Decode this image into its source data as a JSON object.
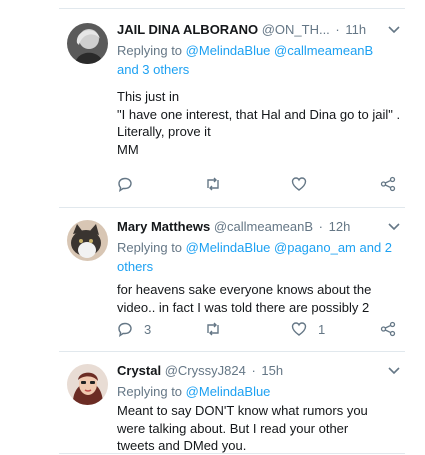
{
  "tweets": [
    {
      "name": "JAIL DINA ALBORANO",
      "handle": "@ON_TH...",
      "sep": "·",
      "time": "11h",
      "reply_prefix": "Replying to",
      "reply_to": "@MelindaBlue @callmeameanB",
      "reply_to_2": "and 3 others",
      "body": "This just in\n\"I have one interest, that Hal and Dina go to jail\" .\nLiterally, prove it\nMM",
      "reply_count": "",
      "like_count": ""
    },
    {
      "name": "Mary Matthews",
      "handle": "@callmeameanB",
      "sep": "·",
      "time": "12h",
      "reply_prefix": "Replying to",
      "reply_to": "@MelindaBlue @pagano_am and 2",
      "reply_to_2": "others",
      "body": "for heavens sake everyone knows about the video.. in fact I was told there are possibly 2",
      "reply_count": "3",
      "like_count": "1"
    },
    {
      "name": "Crystal",
      "handle": "@CryssyJ824",
      "sep": "·",
      "time": "15h",
      "reply_prefix": "Replying to",
      "reply_to": "@MelindaBlue",
      "reply_to_2": "",
      "body": "Meant to say DON'T know what rumors you were talking about. But I read your other tweets and DMed you.",
      "reply_count": "",
      "like_count": ""
    }
  ],
  "icons": {
    "reply": "reply-icon",
    "retweet": "retweet-icon",
    "like": "heart-icon",
    "share": "share-icon",
    "menu": "chevron-down-icon"
  },
  "colors": {
    "text": "#14171a",
    "muted": "#657786",
    "link": "#1da1f2",
    "divider": "#e1e8ed"
  }
}
